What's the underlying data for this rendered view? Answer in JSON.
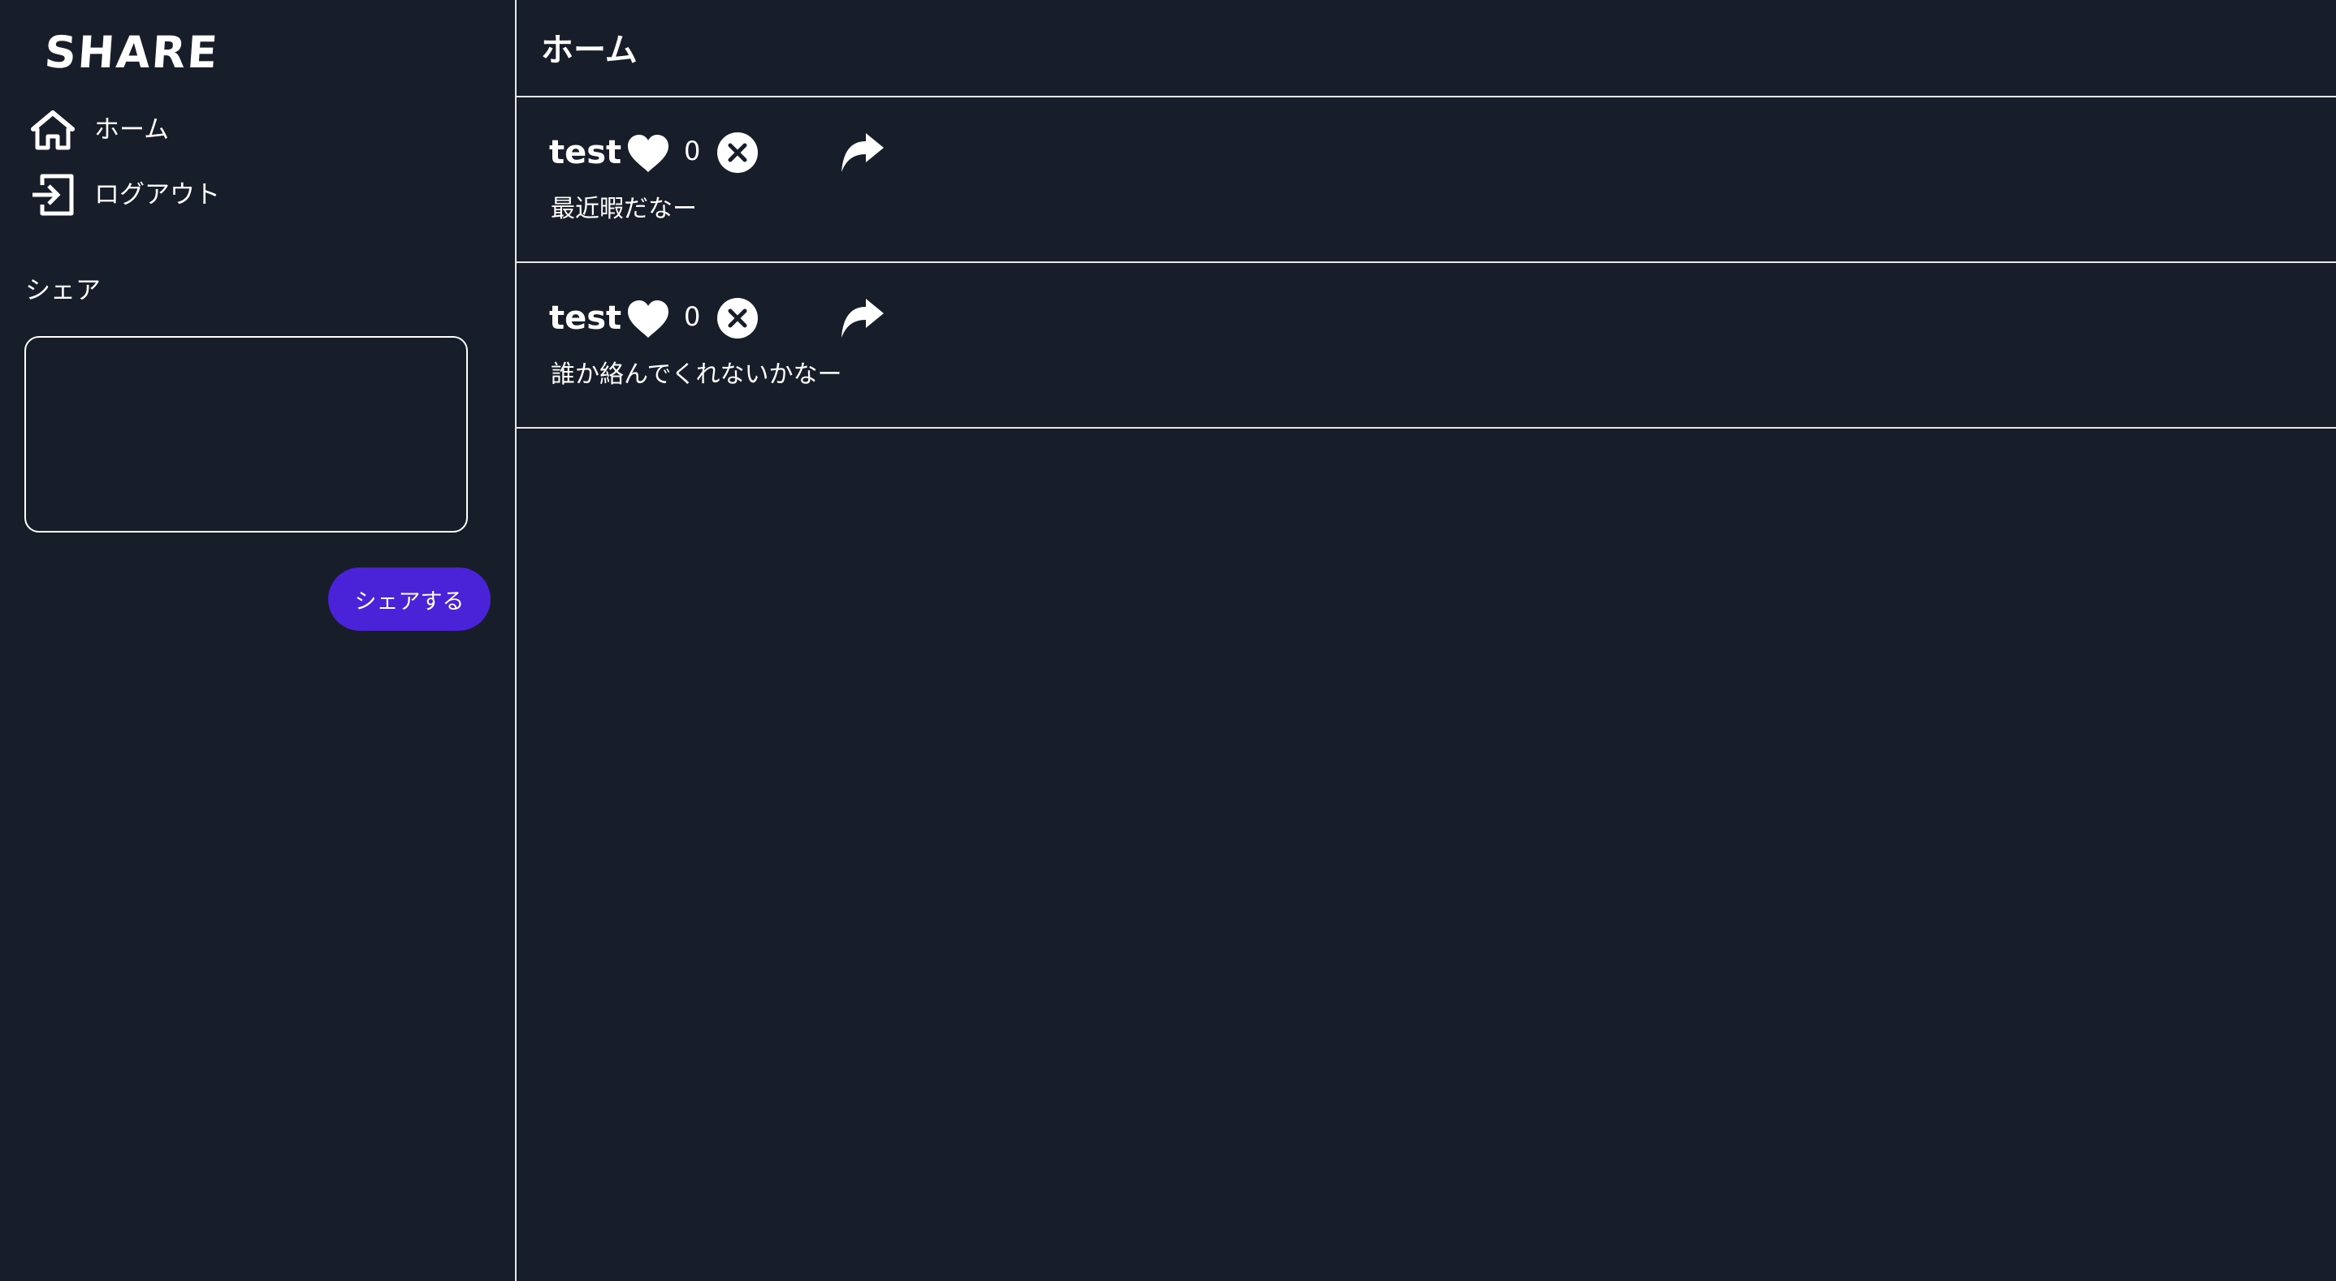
{
  "app": {
    "logo": "SHARE"
  },
  "sidebar": {
    "nav": [
      {
        "label": "ホーム",
        "icon": "home-icon"
      },
      {
        "label": "ログアウト",
        "icon": "logout-icon"
      }
    ],
    "share_title": "シェア",
    "share_input": {
      "value": "",
      "placeholder": ""
    },
    "share_button": "シェアする"
  },
  "main": {
    "title": "ホーム",
    "posts": [
      {
        "user": "test",
        "likes": "0",
        "text": "最近暇だなー"
      },
      {
        "user": "test",
        "likes": "0",
        "text": "誰か絡んでくれないかなー"
      }
    ]
  },
  "colors": {
    "background": "#171e29",
    "accent": "#4a22d8",
    "text": "#ffffff",
    "border": "#e7e7e7"
  }
}
